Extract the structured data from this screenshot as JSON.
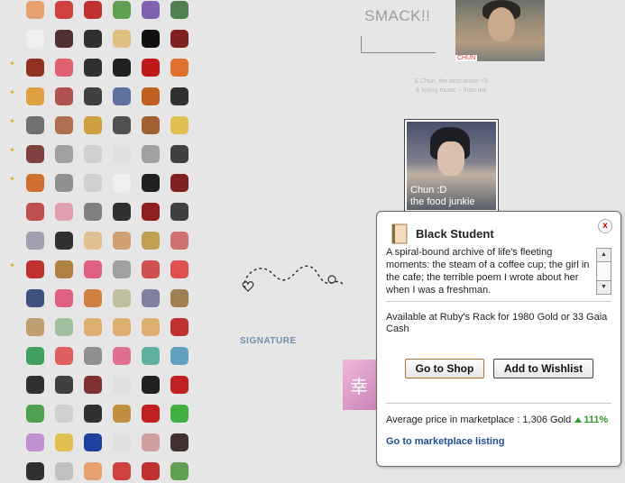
{
  "page": {
    "smack_text": "SMACK!!",
    "photo1_tag": "CHUN",
    "caption_line1": "& Chun, the best bruce <3",
    "caption_line2": "& loving music ~ from me",
    "photo2_line1": "Chun :D",
    "photo2_line2": "the food junkie",
    "signature_label": "SIGNATURE"
  },
  "inventory": {
    "palette": [
      "#e8a070",
      "#d04040",
      "#c03030",
      "#60a050",
      "#8060b0",
      "#508050",
      "#f0f0f0",
      "#503030",
      "#303030",
      "#e0c080",
      "#101010",
      "#802020",
      "#903020",
      "#e06070",
      "#303030",
      "#202020",
      "#c01818",
      "#e07030",
      "#e0a040",
      "#b05050",
      "#404040",
      "#6070a0",
      "#c06020",
      "#303030",
      "#707070",
      "#b07050",
      "#d0a040",
      "#505050",
      "#a06030",
      "#e0c050",
      "#804040",
      "#a0a0a0",
      "#d0d0d0",
      "#e0e0e0",
      "#a0a0a0",
      "#404040",
      "#d07030",
      "#909090",
      "#d0d0d0",
      "#f0f0f0",
      "#202020",
      "#802020",
      "#c05050",
      "#e0a0b0",
      "#808080",
      "#303030",
      "#902020",
      "#404040",
      "#a0a0b0",
      "#303030",
      "#e0c090",
      "#d0a070",
      "#c0a050",
      "#d07070",
      "#c03030",
      "#b08040",
      "#e06080",
      "#a0a0a0",
      "#d05050",
      "#e05050",
      "#405080",
      "#e06080",
      "#d08040",
      "#c0c0a0",
      "#8080a0",
      "#a08050",
      "#c0a070",
      "#a0c0a0",
      "#e0b070",
      "#e0b070",
      "#e0b070",
      "#c03030",
      "#40a060",
      "#e06060",
      "#909090",
      "#e07090",
      "#60b0a0",
      "#60a0c0",
      "#303030",
      "#404040",
      "#803030",
      "#e0e0e0",
      "#202020",
      "#c02020",
      "#50a050",
      "#d0d0d0",
      "#303030",
      "#c09040",
      "#c02020",
      "#40b040",
      "#c090d0",
      "#e0c050",
      "#2040a0",
      "#e0e0e0",
      "#d0a0a0",
      "#403030",
      "#303030",
      "#c0c0c0"
    ]
  },
  "popup": {
    "title": "Black Student",
    "close_label": "x",
    "description": "A spiral-bound archive of life's fleeting moments: the steam of a coffee cup; the girl in the cafe; the terrible poem I wrote about her when I was a freshman.",
    "availability": "Available at Ruby's Rack for 1980 Gold or 33 Gaia Cash",
    "shop_button": "Go to Shop",
    "wishlist_button": "Add to Wishlist",
    "avg_price_label": "Average price in marketplace : 1,306 Gold",
    "avg_change": "111%",
    "market_link": "Go to marketplace listing"
  },
  "colors": {
    "popup_border": "#6a6a6a",
    "link": "#1f4e8e",
    "positive": "#2f9a2f",
    "close": "#c00000",
    "signature": "#6f8fb0"
  }
}
